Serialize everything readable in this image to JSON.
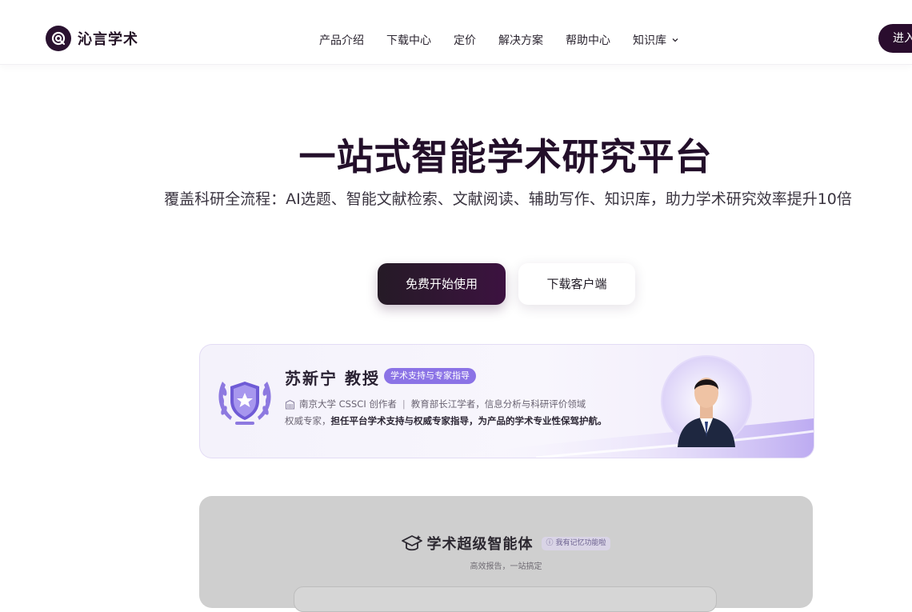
{
  "brand": {
    "name": "沁言学术",
    "icon": "at-sign-logo-icon"
  },
  "nav": {
    "items": [
      {
        "label": "产品介绍"
      },
      {
        "label": "下载中心"
      },
      {
        "label": "定价"
      },
      {
        "label": "解决方案"
      },
      {
        "label": "帮助中心"
      },
      {
        "label": "知识库",
        "icon": "chevron-down-icon"
      }
    ],
    "enter_label": "进入"
  },
  "hero": {
    "title": "一站式智能学术研究平台",
    "subtitle": "覆盖科研全流程：AI选题、智能文献检索、文献阅读、辅助写作、知识库，助力学术研究效率提升10倍",
    "primary_button": "免费开始使用",
    "secondary_button": "下载客户端"
  },
  "expert": {
    "name": "苏新宁 教授",
    "tag": "学术支持与专家指导",
    "affiliation": "南京大学 CSSCI 创作者",
    "separator": "|",
    "title_line": "教育部长江学者，信息分析与科研评价领域",
    "desc_prefix": "权威专家，",
    "desc_strong": "担任平台学术支持与权威专家指导，为产品的学术专业性保驾护航。",
    "colors": {
      "accent": "#8b73e6",
      "card_border": "#e3dcf5"
    }
  },
  "agent": {
    "title": "学术超级智能体",
    "memory_label": "我有记忆功能啦",
    "subtitle": "高效报告，一站搞定",
    "icon": "graduation-cap-icon"
  },
  "colors": {
    "brand_dark": "#2a0d2e",
    "title": "#230f2a"
  }
}
